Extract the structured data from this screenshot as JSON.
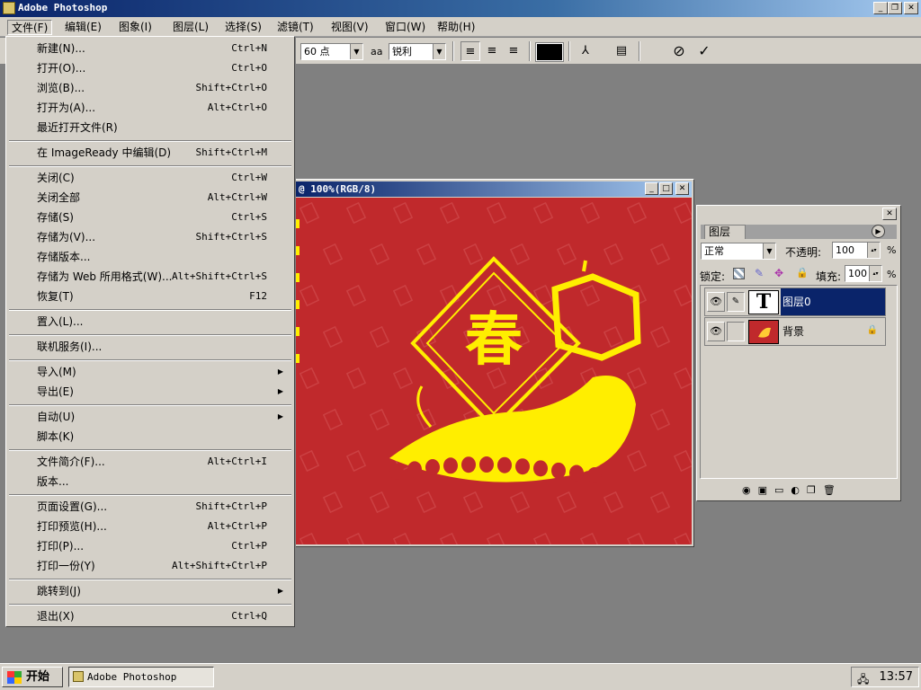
{
  "window": {
    "title": "Adobe Photoshop"
  },
  "menubar": [
    {
      "label": "文件(F)"
    },
    {
      "label": "编辑(E)"
    },
    {
      "label": "图象(I)"
    },
    {
      "label": "图层(L)"
    },
    {
      "label": "选择(S)"
    },
    {
      "label": "滤镜(T)"
    },
    {
      "label": "视图(V)"
    },
    {
      "label": "窗口(W)"
    },
    {
      "label": "帮助(H)"
    }
  ],
  "options": {
    "font_size": "60 点",
    "aa_label": "aa",
    "antialias": "锐利",
    "cancel_icon": "⊘",
    "commit_icon": "✓",
    "text_color": "#000000"
  },
  "document": {
    "title": "@ 100%(RGB/8)",
    "canvas_color": "#c0292c",
    "art_color": "#ffee00",
    "art_text": "春"
  },
  "file_menu": {
    "groups": [
      [
        {
          "label": "新建(N)...",
          "shortcut": "Ctrl+N"
        },
        {
          "label": "打开(O)...",
          "shortcut": "Ctrl+O"
        },
        {
          "label": "浏览(B)...",
          "shortcut": "Shift+Ctrl+O"
        },
        {
          "label": "打开为(A)...",
          "shortcut": "Alt+Ctrl+O"
        },
        {
          "label": "最近打开文件(R)",
          "shortcut": ""
        }
      ],
      [
        {
          "label": "在 ImageReady 中编辑(D)",
          "shortcut": "Shift+Ctrl+M"
        }
      ],
      [
        {
          "label": "关闭(C)",
          "shortcut": "Ctrl+W"
        },
        {
          "label": "关闭全部",
          "shortcut": "Alt+Ctrl+W"
        },
        {
          "label": "存储(S)",
          "shortcut": "Ctrl+S"
        },
        {
          "label": "存储为(V)...",
          "shortcut": "Shift+Ctrl+S"
        },
        {
          "label": "存储版本...",
          "shortcut": ""
        },
        {
          "label": "存储为 Web 所用格式(W)...",
          "shortcut": "Alt+Shift+Ctrl+S"
        },
        {
          "label": "恢复(T)",
          "shortcut": "F12"
        }
      ],
      [
        {
          "label": "置入(L)...",
          "shortcut": ""
        }
      ],
      [
        {
          "label": "联机服务(I)...",
          "shortcut": ""
        }
      ],
      [
        {
          "label": "导入(M)",
          "shortcut": "",
          "submenu": true
        },
        {
          "label": "导出(E)",
          "shortcut": "",
          "submenu": true
        }
      ],
      [
        {
          "label": "自动(U)",
          "shortcut": "",
          "submenu": true
        },
        {
          "label": "脚本(K)",
          "shortcut": ""
        }
      ],
      [
        {
          "label": "文件简介(F)...",
          "shortcut": "Alt+Ctrl+I"
        },
        {
          "label": "版本...",
          "shortcut": ""
        }
      ],
      [
        {
          "label": "页面设置(G)...",
          "shortcut": "Shift+Ctrl+P"
        },
        {
          "label": "打印预览(H)...",
          "shortcut": "Alt+Ctrl+P"
        },
        {
          "label": "打印(P)...",
          "shortcut": "Ctrl+P"
        },
        {
          "label": "打印一份(Y)",
          "shortcut": "Alt+Shift+Ctrl+P"
        }
      ],
      [
        {
          "label": "跳转到(J)",
          "shortcut": "",
          "submenu": true
        }
      ],
      [
        {
          "label": "退出(X)",
          "shortcut": "Ctrl+Q"
        }
      ]
    ]
  },
  "layers_panel": {
    "tab": "图层",
    "blend_mode": "正常",
    "opacity_label": "不透明:",
    "opacity": "100",
    "lock_label": "锁定:",
    "fill_label": "填充:",
    "fill": "100",
    "percent": "%",
    "layers": [
      {
        "name": "图层0",
        "selected": true,
        "thumb": "T"
      },
      {
        "name": "背景",
        "selected": false,
        "locked": true
      }
    ]
  },
  "taskbar": {
    "start": "开始",
    "task": "Adobe Photoshop",
    "clock": "13:57"
  }
}
